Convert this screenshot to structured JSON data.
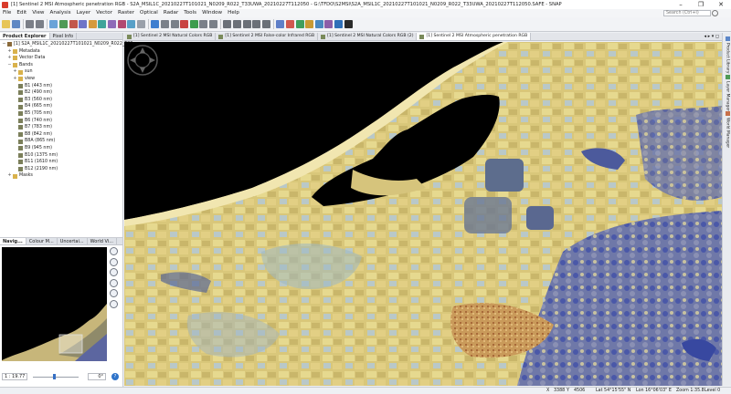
{
  "window": {
    "title": "[1] Sentinel 2 MSI Atmospheric penetration RGB - S2A_MSIL1C_20210227T101021_N0209_R022_T33UWA_20210227T112050 - G:\\TFDO\\S2MSI\\S2A_MSIL1C_20210227T101021_N0209_R022_T33UWA_20210227T112050.SAFE - SNAP",
    "minimize": "–",
    "maximize": "❐",
    "close": "✕"
  },
  "menu": [
    "File",
    "Edit",
    "View",
    "Analysis",
    "Layer",
    "Vector",
    "Raster",
    "Optical",
    "Radar",
    "Tools",
    "Window",
    "Help"
  ],
  "search": {
    "placeholder": "Search (Ctrl+I)"
  },
  "product_explorer": {
    "tabs": [
      "Product Explorer",
      "Pixel Info"
    ],
    "product_name": "[1] S2A_MSIL1C_20210227T101021_N0209_R022_T33...",
    "folders": [
      "Metadata",
      "Vector Data",
      "Bands",
      "sun",
      "view",
      "Masks"
    ],
    "bands": [
      "B1 (443 nm)",
      "B2 (490 nm)",
      "B3 (560 nm)",
      "B4 (665 nm)",
      "B5 (705 nm)",
      "B6 (740 nm)",
      "B7 (783 nm)",
      "B8 (842 nm)",
      "B8A (865 nm)",
      "B9 (945 nm)",
      "B10 (1375 nm)",
      "B11 (1610 nm)",
      "B12 (2190 nm)"
    ]
  },
  "navigation": {
    "tabs": [
      "Navig...",
      "Colour M...",
      "Uncertai...",
      "World Vi..."
    ],
    "zoom_value": "1 : 19.77",
    "rotation_value": "0°",
    "help": "?",
    "slider_fraction": 0.47
  },
  "doc_tabs": [
    "[1] Sentinel 2 MSI Natural Colors RGB",
    "[1] Sentinel 2 MSI False-color Infrared RGB",
    "[1] Sentinel 2 MSI Natural Colors RGB (2)",
    "[1] Sentinel 2 MSI Atmospheric penetration RGB"
  ],
  "doc_tabs_arrows": "◂ ▸ ▾ ◻",
  "right_tabs": [
    "Product Library",
    "Layer Manager",
    "World Manager"
  ],
  "status": {
    "x_label": "X",
    "x_value": "3388",
    "y_label": "Y",
    "y_value": "4506",
    "lat": "Lat 54°15'55\" N",
    "lon": "Lon 16°06'03\" E",
    "zoom": "Zoom 1:35.8",
    "level": "Level 0"
  },
  "colors": {
    "accent": "#2e73c9",
    "sea": "#000000",
    "land": "#d8c878",
    "forest": "#4a58a8"
  }
}
